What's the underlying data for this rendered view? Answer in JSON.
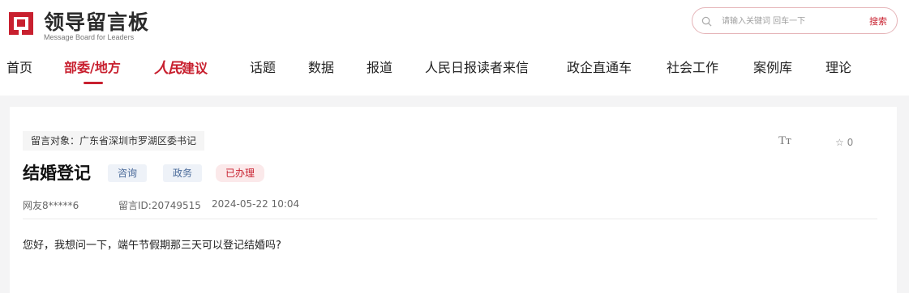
{
  "brand": {
    "title": "领导留言板",
    "subtitle": "Message Board for Leaders",
    "accent_color": "#c8202f"
  },
  "search": {
    "placeholder": "请输入关键词 回车一下",
    "button_label": "搜索",
    "icon": "search-icon"
  },
  "nav": {
    "items": [
      {
        "label": "首页"
      },
      {
        "label": "部委/地方",
        "active": true
      },
      {
        "label_script": "人民",
        "label_rest": "建议"
      },
      {
        "label": "话题"
      },
      {
        "label": "数据"
      },
      {
        "label": "报道"
      },
      {
        "label": "人民日报读者来信"
      },
      {
        "label": "政企直通车"
      },
      {
        "label": "社会工作"
      },
      {
        "label": "案例库"
      },
      {
        "label": "理论"
      }
    ]
  },
  "message": {
    "target": "留言对象：广东省深圳市罗湖区委书记",
    "title": "结婚登记",
    "tags": [
      "咨询",
      "政务",
      "已办理"
    ],
    "user": "网友8*****6",
    "id_text": "留言ID:20749515",
    "datetime": "2024-05-22 10:04",
    "content": "您好，我想问一下，端午节假期那三天可以登记结婚吗?",
    "font_size_label": "Tт",
    "favorite_count": "0",
    "favorite_icon": "star-outline-icon"
  }
}
